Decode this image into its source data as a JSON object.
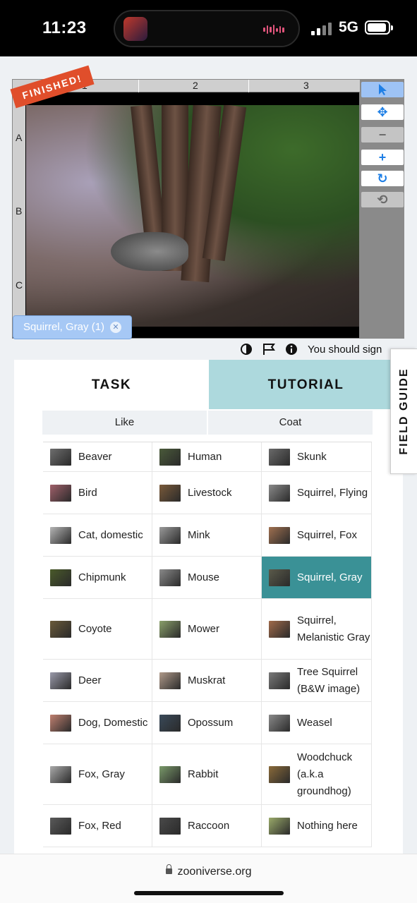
{
  "status_bar": {
    "time": "11:23",
    "network": "5G"
  },
  "viewer": {
    "badge": "FINISHED!",
    "grid_columns": [
      "1",
      "2",
      "3"
    ],
    "grid_rows": [
      "A",
      "B",
      "C"
    ],
    "annotation_tag": "Squirrel, Gray (1)",
    "tools": [
      "pointer-icon",
      "move-icon",
      "zoom-out-icon",
      "zoom-in-icon",
      "rotate-icon",
      "reset-icon"
    ]
  },
  "meta": {
    "sign_in_text": "You should sign"
  },
  "field_guide": {
    "label": "FIELD GUIDE"
  },
  "tabs": {
    "task": "TASK",
    "tutorial": "TUTORIAL"
  },
  "filters": {
    "like": "Like",
    "coat": "Coat"
  },
  "species": [
    {
      "label": "Beaver",
      "color": "#6e6e6e"
    },
    {
      "label": "Human",
      "color": "#4a5a3a"
    },
    {
      "label": "Skunk",
      "color": "#6a6a6a"
    },
    {
      "label": "Bird",
      "color": "#a0606a"
    },
    {
      "label": "Livestock",
      "color": "#7a5a3a"
    },
    {
      "label": "Squirrel, Flying",
      "color": "#8a8a8a"
    },
    {
      "label": "Cat, domestic",
      "color": "#b5b5b5"
    },
    {
      "label": "Mink",
      "color": "#9a9a9a"
    },
    {
      "label": "Squirrel, Fox",
      "color": "#a07050"
    },
    {
      "label": "Chipmunk",
      "color": "#4a5a2a"
    },
    {
      "label": "Mouse",
      "color": "#8a8a8a"
    },
    {
      "label": "Squirrel, Gray",
      "color": "#5a5a4a"
    },
    {
      "label": "Coyote",
      "color": "#6a5a3a"
    },
    {
      "label": "Mower",
      "color": "#8aa06a"
    },
    {
      "label": "Squirrel, Melanistic Gray",
      "color": "#a06a4a"
    },
    {
      "label": "Deer",
      "color": "#9a9aaa"
    },
    {
      "label": "Muskrat",
      "color": "#b09a8a"
    },
    {
      "label": "Tree Squirrel (B&W image)",
      "color": "#7a7a7a"
    },
    {
      "label": "Dog, Domestic",
      "color": "#c08070"
    },
    {
      "label": "Opossum",
      "color": "#3a4a5a"
    },
    {
      "label": "Weasel",
      "color": "#8a8a8a"
    },
    {
      "label": "Fox, Gray",
      "color": "#aaaaaa"
    },
    {
      "label": "Rabbit",
      "color": "#7a9a6a"
    },
    {
      "label": "Woodchuck (a.k.a groundhog)",
      "color": "#8a6a3a"
    },
    {
      "label": "Fox, Red",
      "color": "#5a5a5a"
    },
    {
      "label": "Raccoon",
      "color": "#4a4a4a"
    },
    {
      "label": "Nothing here",
      "color": "#9aaa6a"
    }
  ],
  "selected_species": "Squirrel, Gray",
  "browser": {
    "url": "zooniverse.org"
  },
  "colors": {
    "accent_teal": "#3a9196",
    "tutorial_tab": "#add9dd",
    "finished_badge": "#e04e2b",
    "tag_blue": "#a6c8f5"
  }
}
